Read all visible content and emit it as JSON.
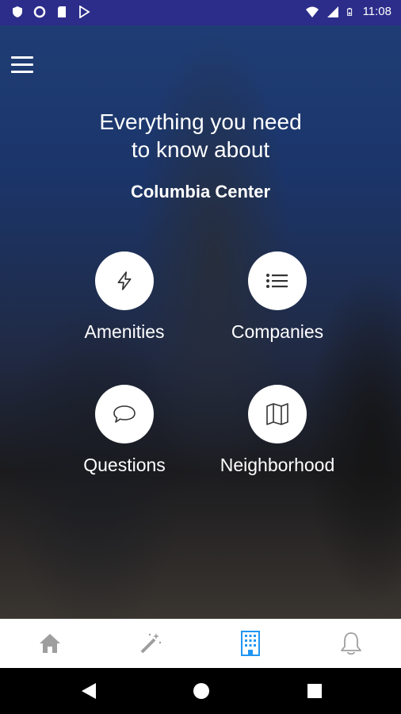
{
  "status_bar": {
    "time": "11:08",
    "left_icons": [
      "shield-icon",
      "circle-icon",
      "sd-card-icon",
      "play-store-icon"
    ],
    "right_icons": [
      "wifi-icon",
      "signal-icon",
      "battery-icon"
    ]
  },
  "header": {
    "headline_line1": "Everything you need",
    "headline_line2": "to know about",
    "building_name": "Columbia Center"
  },
  "tiles": [
    {
      "label": "Amenities",
      "icon": "lightning-icon"
    },
    {
      "label": "Companies",
      "icon": "list-icon"
    },
    {
      "label": "Questions",
      "icon": "chat-bubble-icon"
    },
    {
      "label": "Neighborhood",
      "icon": "map-icon"
    }
  ],
  "bottom_nav": {
    "items": [
      {
        "icon": "home-icon"
      },
      {
        "icon": "magic-wand-icon"
      },
      {
        "icon": "building-icon",
        "active": true
      },
      {
        "icon": "bell-icon"
      }
    ],
    "active_color": "#2196f3",
    "inactive_color": "#9e9e9e"
  },
  "colors": {
    "status_bar": "#2c2d8a",
    "tile_icon": "#333333"
  }
}
